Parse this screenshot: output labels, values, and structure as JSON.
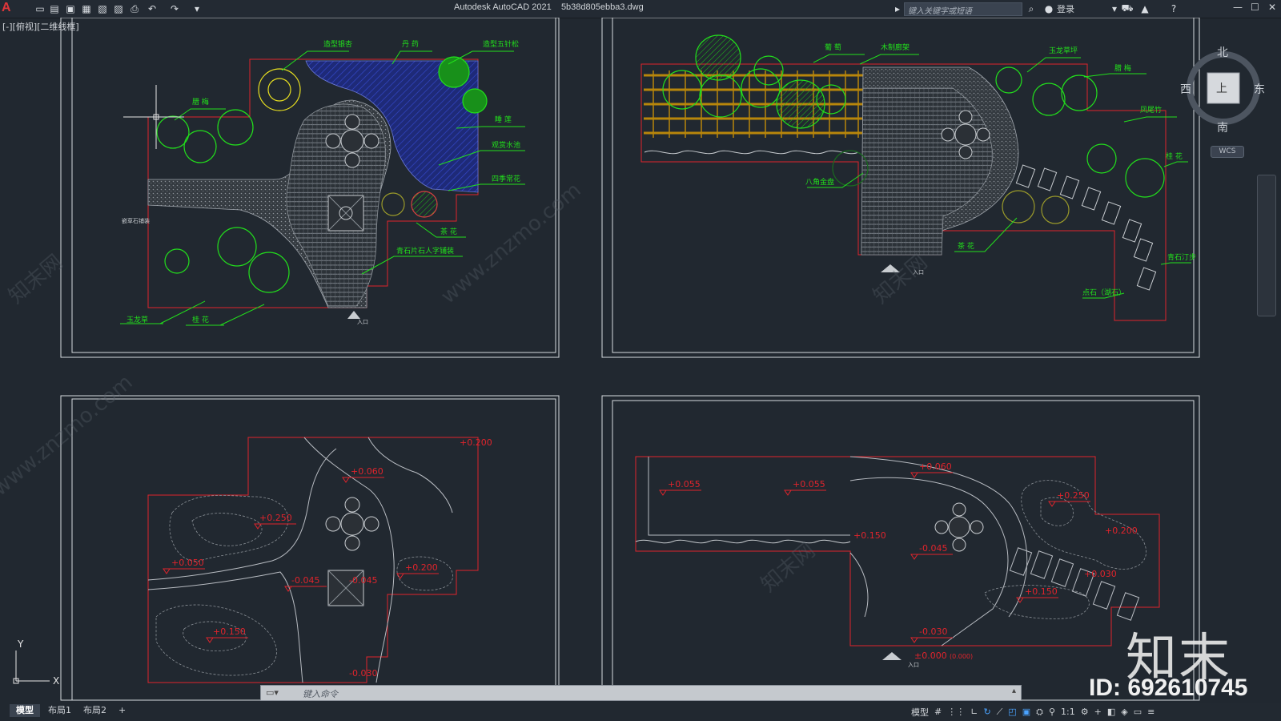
{
  "app": {
    "name": "Autodesk AutoCAD 2021",
    "file": "5b38d805ebba3.dwg",
    "logo": "A"
  },
  "toolbar": {
    "search_placeholder": "键入关键字或短语",
    "login_label": "登录",
    "icons": [
      "new-file-icon",
      "open-file-icon",
      "save-icon",
      "save-as-icon",
      "print-preview-icon",
      "publish-icon",
      "print-icon",
      "undo-icon",
      "redo-icon",
      "customize-icon"
    ]
  },
  "viewport": {
    "label": "[-][俯视][二维线框]"
  },
  "viewcube": {
    "north": "北",
    "south": "南",
    "east": "东",
    "west": "西",
    "face": "上",
    "wcs": "WCS"
  },
  "ucs": {
    "x": "X",
    "y": "Y"
  },
  "plan1": {
    "labels": {
      "a": "造型银杏",
      "b": "丹    药",
      "c": "造型五针松",
      "d": "腊    梅",
      "e": "睡    莲",
      "f": "观赏水池",
      "g": "四季常花",
      "h": "茶    花",
      "i": "青石片石人字铺装",
      "j": "玉龙草",
      "k": "桂    花",
      "l": "嵌草石铺装",
      "m": "入口"
    }
  },
  "plan2": {
    "labels": {
      "a": "葡    萄",
      "b": "木制廊架",
      "c": "玉龙草坪",
      "d": "腊    梅",
      "e": "凤尾竹",
      "f": "桂    花",
      "g": "八角金盘",
      "h": "茶    花",
      "i": "青石汀步",
      "j": "点石（湖石）",
      "k": "入口"
    }
  },
  "plan3": {
    "elevations": {
      "a": "+0.060",
      "b": "+0.200",
      "c": "+0.250",
      "d": "+0.050",
      "e": "-0.045",
      "f": "-0.045",
      "g": "+0.200",
      "h": "+0.150",
      "i": "-0.030"
    }
  },
  "plan4": {
    "elevations": {
      "a": "+0.055",
      "b": "+0.055",
      "c": "+0.060",
      "d": "+0.150",
      "e": "-0.045",
      "f": "+0.250",
      "g": "+0.200",
      "h": "+0.030",
      "i": "+0.150",
      "j": "-0.030",
      "k": "±0.000",
      "l": "(0.000)",
      "m": "入口"
    }
  },
  "command": {
    "prompt": "键入命令"
  },
  "layouts": {
    "model": "模型",
    "layout1": "布局1",
    "layout2": "布局2",
    "add": "+"
  },
  "statusbar": {
    "model": "模型",
    "scale": "1:1"
  },
  "watermark": {
    "logo": "知末",
    "id": "ID: 692610745",
    "site": "www.znzmo.com",
    "brand": "知末网"
  },
  "colors": {
    "background": "#212830",
    "red": "#e0242c",
    "green": "#22e01c",
    "yellow": "#e8e020",
    "blue": "#2b3aa8",
    "white": "#e6e6e6",
    "gray": "#9aa0a8"
  }
}
